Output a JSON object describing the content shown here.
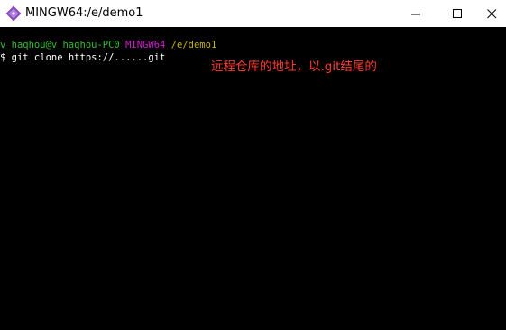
{
  "window": {
    "title": "MINGW64:/e/demo1",
    "icon": "git-bash-icon",
    "controls": [
      "minimize-icon",
      "maximize-icon",
      "close-icon"
    ]
  },
  "terminal": {
    "prompt": {
      "user": "v_haqhou@v_haqhou-PC0",
      "host": "MINGW64",
      "path": "/e/demo1"
    },
    "command": "$ git clone https://......git",
    "colors": {
      "background": "#000000",
      "user": "#2fbf2f",
      "host": "#d01fd0",
      "path": "#c8b400",
      "text": "#ffffff"
    }
  },
  "annotation": {
    "text": "远程仓库的地址，以.git结尾的",
    "color": "#ff3b2f"
  }
}
